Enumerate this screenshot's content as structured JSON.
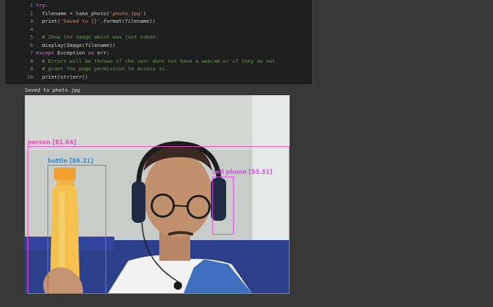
{
  "cell": {
    "run_indicator": "[ ]",
    "lines": [
      {
        "n": "1",
        "parts": [
          {
            "t": "try:",
            "c": "kw"
          }
        ]
      },
      {
        "n": "2",
        "parts": [
          {
            "t": "  filename = take_photo(",
            "c": ""
          },
          {
            "t": "'photo.jpg'",
            "c": "str"
          },
          {
            "t": ")",
            "c": ""
          }
        ]
      },
      {
        "n": "3",
        "parts": [
          {
            "t": "  print(",
            "c": ""
          },
          {
            "t": "'Saved to {}'",
            "c": "str"
          },
          {
            "t": ".format(filename))",
            "c": ""
          }
        ]
      },
      {
        "n": "4",
        "parts": []
      },
      {
        "n": "5",
        "parts": [
          {
            "t": "  # Show the image which was just taken.",
            "c": "cm"
          }
        ]
      },
      {
        "n": "6",
        "parts": [
          {
            "t": "  display(Image(filename))",
            "c": ""
          }
        ]
      },
      {
        "n": "7",
        "parts": [
          {
            "t": "except",
            "c": "kw"
          },
          {
            "t": " Exception ",
            "c": ""
          },
          {
            "t": "as",
            "c": "kw"
          },
          {
            "t": " err:",
            "c": ""
          }
        ]
      },
      {
        "n": "8",
        "parts": [
          {
            "t": "  # Errors will be thrown if the user does not have a webcam or if they do not",
            "c": "cm"
          }
        ]
      },
      {
        "n": "9",
        "parts": [
          {
            "t": "  # grant the page permission to access it.",
            "c": "cm"
          }
        ]
      },
      {
        "n": "10",
        "parts": [
          {
            "t": "  print(str(err))",
            "c": ""
          }
        ]
      }
    ]
  },
  "output": {
    "text": "Saved to photo.jpg"
  },
  "detections": [
    {
      "id": "person",
      "label": "person [81.64]",
      "color": "#e84fbf"
    },
    {
      "id": "bottle",
      "label": "bottle [86.21]",
      "color": "#3a8fd1"
    },
    {
      "id": "cell-phone",
      "label": "cell phone [53.31]",
      "color": "#d64fe0"
    }
  ]
}
